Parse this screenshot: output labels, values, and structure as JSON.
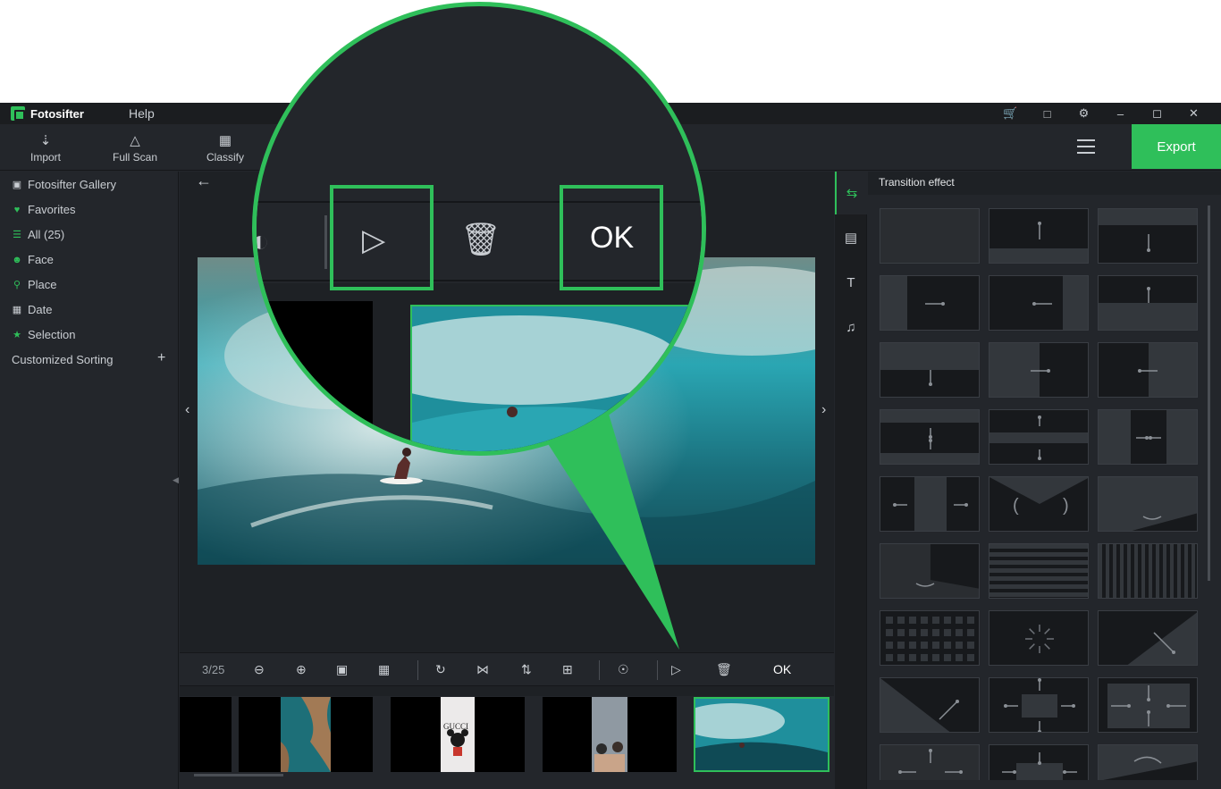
{
  "app": {
    "title": "Fotosifter",
    "menu": [
      "Help"
    ]
  },
  "titlebar_icons": [
    "cart-icon",
    "store-icon",
    "settings-icon",
    "minimize-icon",
    "maximize-icon",
    "close-icon"
  ],
  "toolbar": {
    "import_label": "Import",
    "fullscan_label": "Full Scan",
    "classify_label": "Classify",
    "export_label": "Export"
  },
  "sidebar": {
    "items": [
      {
        "label": "Fotosifter Gallery",
        "icon": "gallery-icon"
      },
      {
        "label": "Favorites",
        "icon": "heart-icon"
      },
      {
        "label": "All (25)",
        "icon": "list-icon"
      },
      {
        "label": "Face",
        "icon": "face-icon"
      },
      {
        "label": "Place",
        "icon": "pin-icon"
      },
      {
        "label": "Date",
        "icon": "calendar-icon"
      },
      {
        "label": "Selection",
        "icon": "star-icon"
      }
    ],
    "custom_sort_label": "Customized Sorting"
  },
  "viewer": {
    "page_count": "3/25",
    "ok_label": "OK",
    "tools": [
      "zoom-out-icon",
      "zoom-in-icon",
      "fit-icon",
      "actual-size-icon",
      "rotate-icon",
      "flip-horizontal-icon",
      "flip-vertical-icon",
      "crop-icon",
      "eye-icon",
      "slideshow-icon",
      "delete-icon"
    ]
  },
  "filmstrip": {
    "thumbnails": [
      "thumb-dark",
      "thumb-coast",
      "thumb-gucci",
      "thumb-people",
      "thumb-wave-selected"
    ],
    "gucci_text": "GUCCI"
  },
  "right_panel": {
    "title": "Transition effect",
    "tabs": [
      "transition-tab-icon",
      "film-tab-icon",
      "text-tab-icon",
      "music-tab-icon"
    ]
  },
  "magnifier": {
    "ok_label": "OK"
  },
  "colors": {
    "accent": "#2fbf5a",
    "bg": "#23262b",
    "dark": "#1b1d20"
  }
}
